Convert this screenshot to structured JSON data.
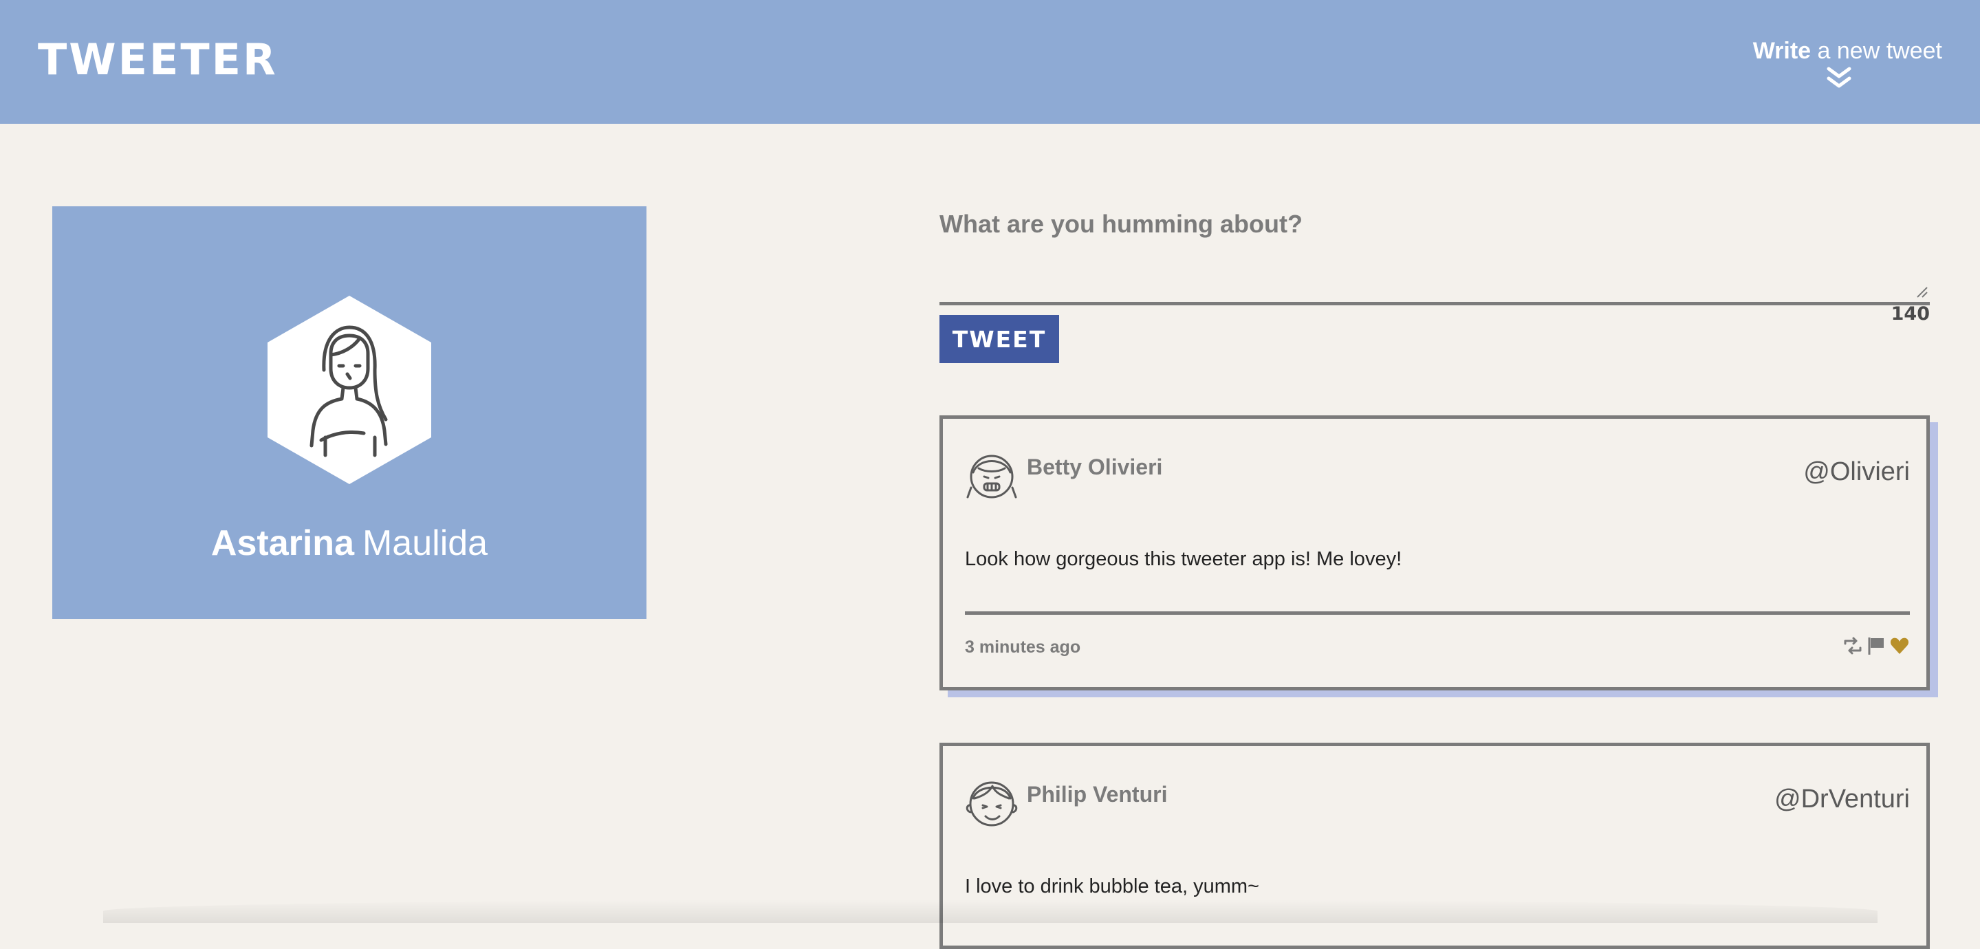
{
  "header": {
    "brand": "TWEETER",
    "compose_toggle": {
      "strong": "Write",
      "rest": "a new tweet"
    }
  },
  "profile": {
    "first_name": "Astarina",
    "last_name": "Maulida"
  },
  "compose": {
    "label": "What are you humming about?",
    "textarea_value": "",
    "button_label": "TWEET",
    "char_count": "140"
  },
  "tweets": [
    {
      "author": "Betty Olivieri",
      "handle": "@Olivieri",
      "body": "Look how gorgeous this tweeter app is! Me lovey!",
      "time": "3 minutes ago"
    },
    {
      "author": "Philip Venturi",
      "handle": "@DrVenturi",
      "body": "I love to drink bubble tea, yumm~"
    }
  ],
  "colors": {
    "header_bg": "#8eaad4",
    "page_bg": "#f4f1ec",
    "button_bg": "#4159a0",
    "card_shadow": "#b9c2e6",
    "like_heart": "#b8902a",
    "border_gray": "#7b7b7b"
  },
  "icons": {
    "compose_toggle": "double-chevron-down-icon",
    "retweet": "retweet-icon",
    "flag": "flag-icon",
    "like": "heart-icon"
  }
}
